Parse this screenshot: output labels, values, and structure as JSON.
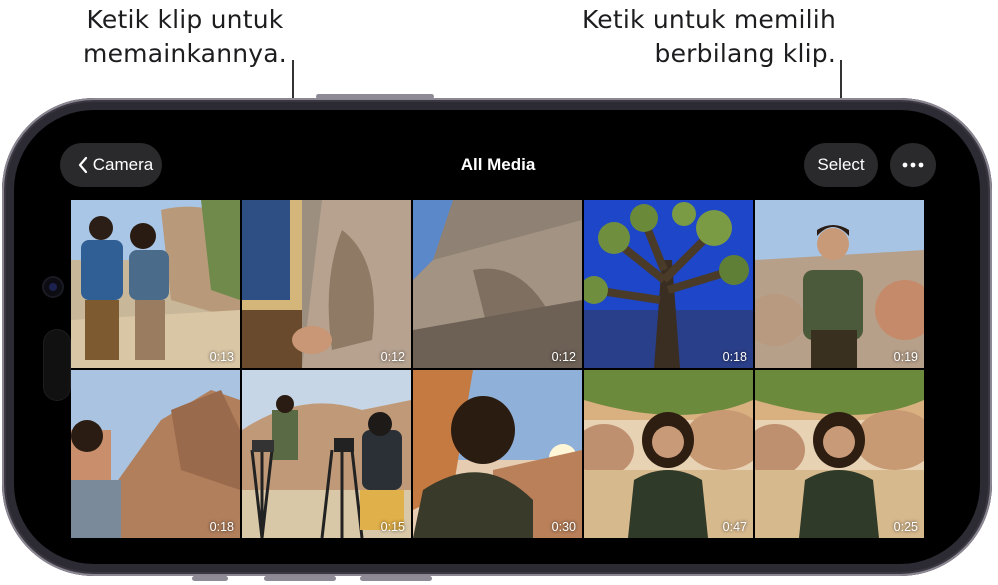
{
  "callouts": {
    "left": {
      "line1": "Ketik klip untuk",
      "line2": "memainkannya."
    },
    "right": {
      "line1": "Ketik untuk memilih",
      "line2": "berbilang klip."
    }
  },
  "nav": {
    "back_label": "Camera",
    "title": "All Media",
    "select_label": "Select",
    "more_icon": "ellipsis-icon"
  },
  "clips": [
    {
      "duration": "0:13",
      "scene": "two people hiking with backpacks"
    },
    {
      "duration": "0:12",
      "scene": "hand on boulder"
    },
    {
      "duration": "0:12",
      "scene": "rock closeup"
    },
    {
      "duration": "0:18",
      "scene": "joshua tree against blue sky"
    },
    {
      "duration": "0:19",
      "scene": "man sitting on rocks"
    },
    {
      "duration": "0:18",
      "scene": "man by boulders"
    },
    {
      "duration": "0:15",
      "scene": "film crew with cameras"
    },
    {
      "duration": "0:30",
      "scene": "silhouette at sunset"
    },
    {
      "duration": "0:47",
      "scene": "woman under joshua tree"
    },
    {
      "duration": "0:25",
      "scene": "woman under joshua tree"
    }
  ],
  "colors": {
    "screen_bg": "#000000",
    "pill_bg": "#2a2a2c",
    "frame": "#2c2a33"
  }
}
